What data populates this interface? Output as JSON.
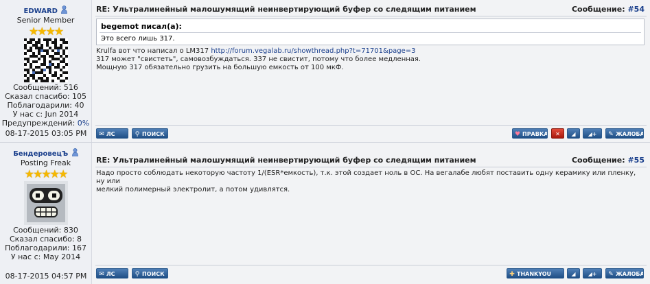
{
  "posts": [
    {
      "username": "EDWARD",
      "rank": "Senior Member",
      "stars": 4,
      "stats": {
        "messages": "Сообщений: 516",
        "thanked": "Сказал спасибо: 105",
        "thanks_received": "Поблагодарили: 40",
        "joined": "У нас с: Jun 2014",
        "warnings_label": "Предупреждений:",
        "warnings_value": "0%"
      },
      "date": "08-17-2015 03:05 PM",
      "title": "RE: Ультралинейный малошумящий неинвертирующий буфер со следящим питанием",
      "msg_label": "Сообщение:",
      "msg_num": "#54",
      "quote": {
        "author": "begemot писал(а):",
        "text": "Это всего лишь 317."
      },
      "body": {
        "line1_prefix": "Krulfa вот что написал о LM317 ",
        "line1_link": "http://forum.vegalab.ru/showthread.php?t=71701&page=3",
        "line2": "317 может \"свистеть\", самовозбуждаться. 337 не свистит, потому что более медленная.",
        "line3": "Мощную 317 обязательно грузить на большую емкость от 100 мкФ."
      },
      "buttons": {
        "pm": "ЛС",
        "search": "ПОИСК",
        "edit": "ПРАВКА",
        "complaint": "ЖАЛОБА"
      }
    },
    {
      "username": "БендеровецЪ",
      "rank": "Posting Freak",
      "stars": 5,
      "stats": {
        "messages": "Сообщений: 830",
        "thanked": "Сказал спасибо: 8",
        "thanks_received": "Поблагодарили: 167",
        "joined": "У нас с: May 2014"
      },
      "date": "08-17-2015 04:57 PM",
      "title": "RE: Ультралинейный малошумящий неинвертирующий буфер со следящим питанием",
      "msg_label": "Сообщение:",
      "msg_num": "#55",
      "body": {
        "line1": "Надо просто соблюдать некоторую частоту 1/(ESR*емкость), т.к. этой создает ноль в ОС. На вегалабе любят поставить одну керамику или пленку, ну или",
        "line2": "мелкий полимерный электролит, а потом удивлятся."
      },
      "buttons": {
        "pm": "ЛС",
        "search": "ПОИСК",
        "thank": "THANKYOU",
        "complaint": "ЖАЛОБА"
      }
    }
  ],
  "colors": {
    "link": "#1a3f8c",
    "button": "#2e5f97",
    "star": "#f5b800",
    "row_bg": "#f2f3f5"
  }
}
